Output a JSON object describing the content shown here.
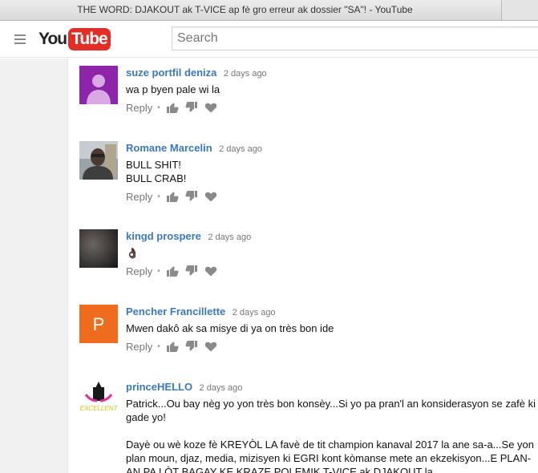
{
  "window": {
    "title": "THE WORD: DJAKOUT ak T-VICE ap fè gro erreur ak dossier \"SA\"! - YouTube"
  },
  "header": {
    "logo_you": "You",
    "logo_tube": "Tube",
    "search_placeholder": "Search"
  },
  "colors": {
    "link": "#3b79bd",
    "brand_red": "#e52d27",
    "avatar_purple": "#8e24aa",
    "avatar_orange": "#ef6c1f"
  },
  "comments": [
    {
      "author": "suze portfil deniza",
      "time": "2 days ago",
      "lines": [
        "wa p byen pale wi la"
      ],
      "avatar": "default-person-purple",
      "reply_label": "Reply"
    },
    {
      "author": "Romane Marcelin",
      "time": "2 days ago",
      "lines": [
        "BULL SHIT!",
        "BULL CRAB!"
      ],
      "avatar": "photo",
      "reply_label": "Reply"
    },
    {
      "author": "kingd prospere",
      "time": "2 days ago",
      "lines": [
        "👌🏿"
      ],
      "avatar": "dark-photo",
      "reply_label": "Reply"
    },
    {
      "author": "Pencher Francillette",
      "time": "2 days ago",
      "lines": [
        "Mwen dakô ak sa misye di ya on très bon ide"
      ],
      "avatar": "letter",
      "avatar_letter": "P",
      "reply_label": "Reply"
    },
    {
      "author": "princeHELLO",
      "time": "2 days ago",
      "lines": [
        "Patrick...Ou bay nèg yo yon très bon konsèy...Si yo pa pran'l an konsiderasyon se zafè ki gade yo!",
        "",
        "Dayè ou wè koze fè KREYÒL LA favè de tit champion kanaval 2017 la ane sa-a...Se yon plan moun, djaz, media, mizisyen ki EGRI kont kòmanse mete an ekzekisyon...E PLAN-AN PA LÒT BAGAY KE KRAZE POLEMIK T-VICE ak DJAKOUT la."
      ],
      "avatar": "logo",
      "avatar_logo_text": "EXCELLENT",
      "reply_label": "Reply"
    }
  ]
}
